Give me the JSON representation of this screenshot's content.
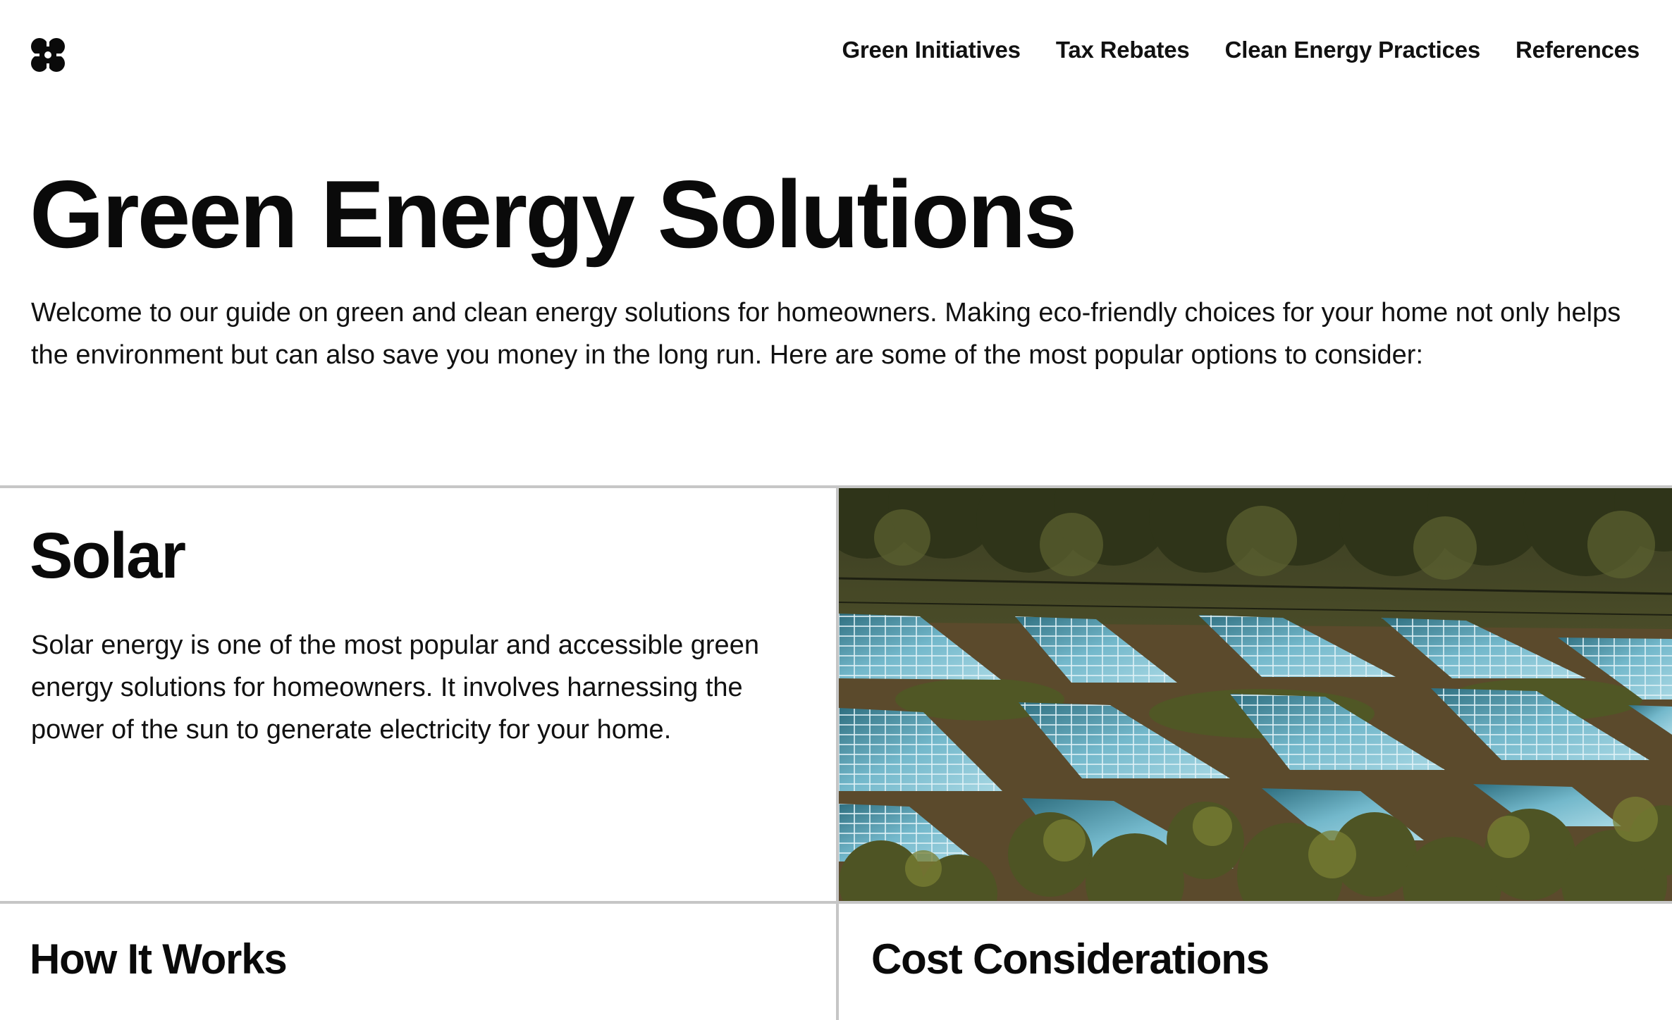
{
  "header": {
    "logo_icon": "four-leaf-clover-icon",
    "nav": [
      {
        "label": "Green Initiatives"
      },
      {
        "label": "Tax Rebates"
      },
      {
        "label": "Clean Energy Practices"
      },
      {
        "label": "References"
      }
    ]
  },
  "hero": {
    "title": "Green Energy Solutions",
    "intro": "Welcome to our guide on green and clean energy solutions for homeowners. Making eco-friendly choices for your home not only helps the environment but can also save you money in the long run. Here are some of the most popular options to consider:"
  },
  "solar": {
    "title": "Solar",
    "description": "Solar energy is one of the most popular and accessible green energy solutions for homeowners. It involves harnessing the power of the sun to generate electricity for your home.",
    "image_subject": "solar panel array on a hillside surrounded by trees"
  },
  "sections": {
    "how_it_works": "How It Works",
    "cost_considerations": "Cost Considerations"
  },
  "colors": {
    "text": "#0a0a0a",
    "divider": "#c6c6c6",
    "panel_blue": "#6fb6c9",
    "foliage": "#4e5424"
  }
}
